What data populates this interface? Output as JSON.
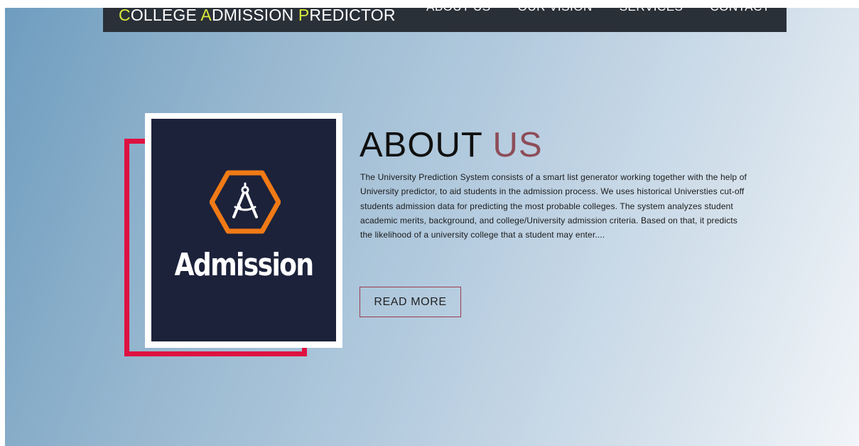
{
  "navbar": {
    "brand": {
      "parts": [
        {
          "initial": "C",
          "rest": "OLLEGE "
        },
        {
          "initial": "A",
          "rest": "DMISSION "
        },
        {
          "initial": "P",
          "rest": "REDICTOR"
        }
      ]
    },
    "links": [
      "ABOUT US",
      "OUR VISION",
      "SERVICES",
      "CONTACT"
    ]
  },
  "image": {
    "logo_text": "Admission",
    "icon": "hexagon-compass-icon"
  },
  "about": {
    "title_main": "ABOUT",
    "title_accent": "US",
    "paragraph": "The University Prediction System consists of a smart list generator working together with the help of University predictor, to aid students in the admission process. We uses historical Universties cut-off students admission data for predicting the most probable colleges. The system analyzes student academic merits, background, and college/University admission criteria. Based on that, it predicts the likelihood of a university college that a student may enter....",
    "button_label": "READ MORE"
  },
  "colors": {
    "brand_accent": "#d7e83a",
    "title_accent": "#8d4d58",
    "frame_red": "#de1141",
    "navbar_bg": "#2a3038",
    "image_bg": "#1c223a",
    "hexagon_orange": "#f07a16"
  }
}
